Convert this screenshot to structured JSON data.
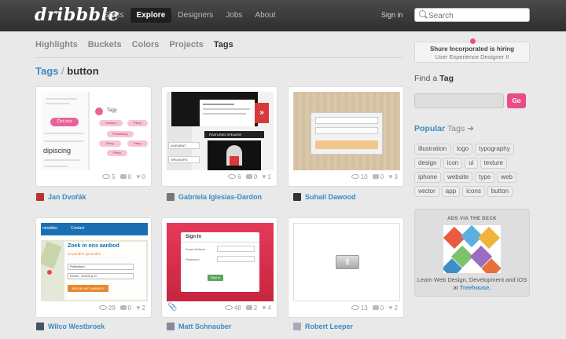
{
  "header": {
    "logo": "dribbble",
    "nav": [
      "Shots",
      "Explore",
      "Designers",
      "Jobs",
      "About"
    ],
    "active_nav": "Explore",
    "signin": "Sign in",
    "search_placeholder": "Search"
  },
  "subnav": [
    "Highlights",
    "Buckets",
    "Colors",
    "Projects",
    "Tags"
  ],
  "current_subnav": "Tags",
  "breadcrumb": {
    "root": "Tags",
    "separator": "/",
    "current": "button"
  },
  "shots": [
    {
      "author": "Jan Dvořák",
      "views": "5",
      "comments": "0",
      "likes": "0",
      "thumb": {
        "btn": "Čist více",
        "tag": "Tagy",
        "chips": [
          "Kreseni",
          "Plecy",
          "Photoshop",
          "Plecy",
          "Plecy",
          "Plecy"
        ],
        "word": "dipiscing"
      }
    },
    {
      "author": "Gabriela Iglesias-Dardon",
      "views": "6",
      "comments": "0",
      "likes": "1",
      "thumb": {
        "banner": "FEATURED SPEAKER",
        "row1": "AGEMENT",
        "row2": "SPEAKERS"
      }
    },
    {
      "author": "Suhail Dawood",
      "views": "10",
      "comments": "0",
      "likes": "3",
      "thumb": {}
    },
    {
      "author": "Wilco Westbroek",
      "views": "29",
      "comments": "0",
      "likes": "2",
      "thumb": {
        "tab1": "nmelden",
        "tab2": "Contact",
        "head": "Zoek in ons aanbod",
        "sub": "23 panden gevonden",
        "sel1": "Rotterdam",
        "sel2": "€1000 - €1000 p.m.",
        "btn": "BEKIJK HET AANBOD"
      }
    },
    {
      "author": "Matt Schnauber",
      "views": "48",
      "comments": "2",
      "likes": "4",
      "thumb": {
        "signin": "Sign In",
        "email": "Email address",
        "password": "Password",
        "btn": "Sign in"
      }
    },
    {
      "author": "Robert Leeper",
      "views": "13",
      "comments": "0",
      "likes": "2",
      "thumb": {}
    }
  ],
  "sidebar": {
    "hiring_title": "Shure Incorporated is hiring",
    "hiring_role": "User Experience Designer II",
    "find_prefix": "Find a",
    "find_word": "Tag",
    "go_label": "Go",
    "popular_title": "Popular",
    "popular_suffix": "Tags ➜",
    "tags": [
      "illustration",
      "logo",
      "typography",
      "design",
      "icon",
      "ui",
      "texture",
      "iphone",
      "website",
      "type",
      "web",
      "vector",
      "app",
      "icons",
      "button"
    ],
    "ads_label": "ADS VIA THE DECK",
    "ads_text": "Learn Web Design, Development and iOS at",
    "ads_link": "Treehouse."
  },
  "colors": {
    "accent": "#ea4c89",
    "link": "#3a8bc0",
    "topbar": "#333333"
  }
}
